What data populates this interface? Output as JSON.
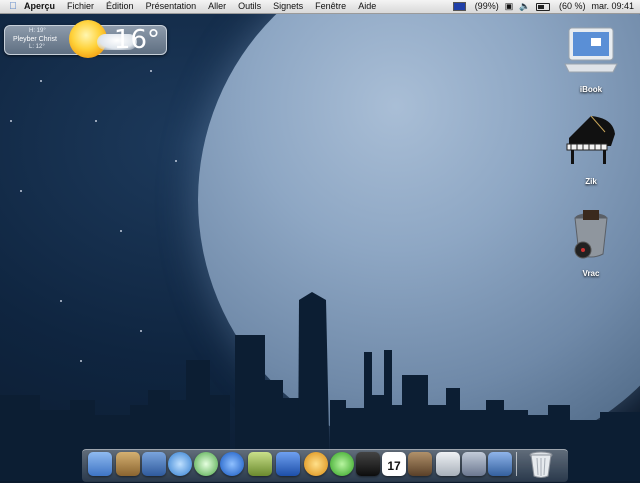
{
  "menubar": {
    "app_name": "Aperçu",
    "items": [
      "Fichier",
      "Édition",
      "Présentation",
      "Aller",
      "Outils",
      "Signets",
      "Fenêtre",
      "Aide"
    ],
    "status": {
      "keyboard_battery": "(99%)",
      "battery": "(60 %)",
      "clock": "mar. 09:41"
    }
  },
  "weather_widget": {
    "temperature": "16°",
    "city": "Pleyber Christ",
    "high": "H: 19°",
    "low": "L: 12°"
  },
  "desktop_icons": [
    {
      "label": "iBook"
    },
    {
      "label": "Zik"
    },
    {
      "label": "Vrac"
    }
  ],
  "dock": {
    "calendar_day": "17",
    "items": [
      {
        "name": "finder",
        "color": "#6b9bd9"
      },
      {
        "name": "address-book",
        "color": "#b38a4a"
      },
      {
        "name": "preview",
        "color": "#4a78b8"
      },
      {
        "name": "safari",
        "color": "#5aa0e0"
      },
      {
        "name": "itunes",
        "color": "#7cc06a"
      },
      {
        "name": "quicktime",
        "color": "#2a70d8"
      },
      {
        "name": "pencil-app",
        "color": "#8fb058"
      },
      {
        "name": "word",
        "color": "#2c64c4"
      },
      {
        "name": "messenger",
        "color": "#e8a030"
      },
      {
        "name": "chat",
        "color": "#4cc33a"
      },
      {
        "name": "terminal",
        "color": "#2a2a2a"
      },
      {
        "name": "ical",
        "color": "#ffffff"
      },
      {
        "name": "music-app",
        "color": "#8a6a4a"
      },
      {
        "name": "system-prefs",
        "color": "#cfd4da"
      },
      {
        "name": "installer",
        "color": "#9aa6b8"
      },
      {
        "name": "iphoto",
        "color": "#5a86c8"
      }
    ]
  }
}
